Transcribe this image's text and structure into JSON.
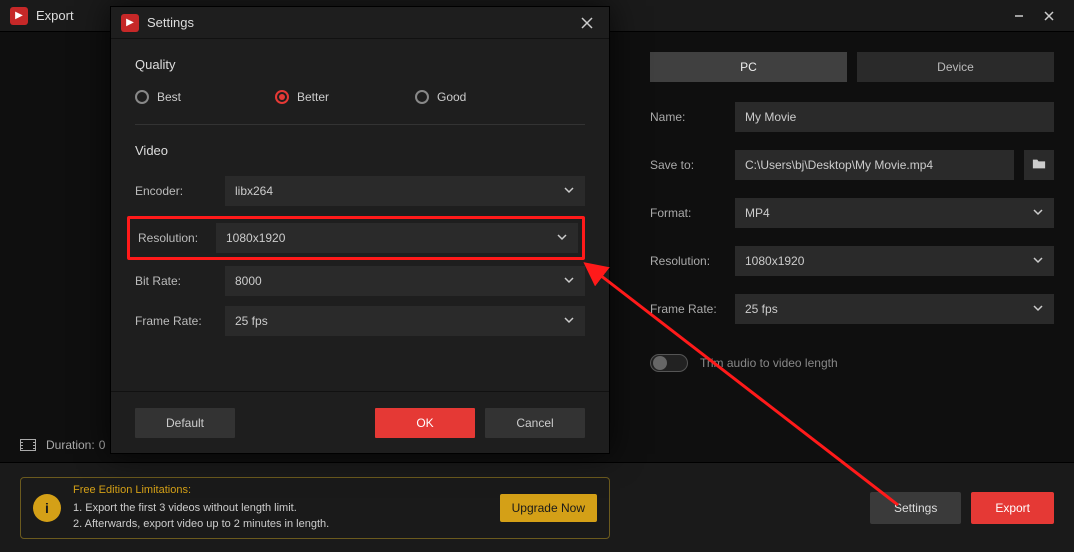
{
  "export_window": {
    "title": "Export",
    "duration_label": "Duration:",
    "duration_value": "0"
  },
  "tabs": {
    "pc": "PC",
    "device": "Device"
  },
  "main_form": {
    "name_label": "Name:",
    "name_value": "My Movie",
    "saveto_label": "Save to:",
    "saveto_value": "C:\\Users\\bj\\Desktop\\My Movie.mp4",
    "format_label": "Format:",
    "format_value": "MP4",
    "resolution_label": "Resolution:",
    "resolution_value": "1080x1920",
    "framerate_label": "Frame Rate:",
    "framerate_value": "25 fps",
    "trim_label": "Trim audio to video length"
  },
  "footer": {
    "limits_header": "Free Edition Limitations:",
    "limits_line1": "1. Export the first 3 videos without length limit.",
    "limits_line2": "2. Afterwards, export video up to 2 minutes in length.",
    "upgrade": "Upgrade Now",
    "settings": "Settings",
    "export": "Export"
  },
  "settings_dialog": {
    "title": "Settings",
    "quality": {
      "section": "Quality",
      "best": "Best",
      "better": "Better",
      "good": "Good"
    },
    "video": {
      "section": "Video",
      "encoder_label": "Encoder:",
      "encoder_value": "libx264",
      "resolution_label": "Resolution:",
      "resolution_value": "1080x1920",
      "bitrate_label": "Bit Rate:",
      "bitrate_value": "8000",
      "framerate_label": "Frame Rate:",
      "framerate_value": "25 fps"
    },
    "buttons": {
      "default": "Default",
      "ok": "OK",
      "cancel": "Cancel"
    }
  }
}
